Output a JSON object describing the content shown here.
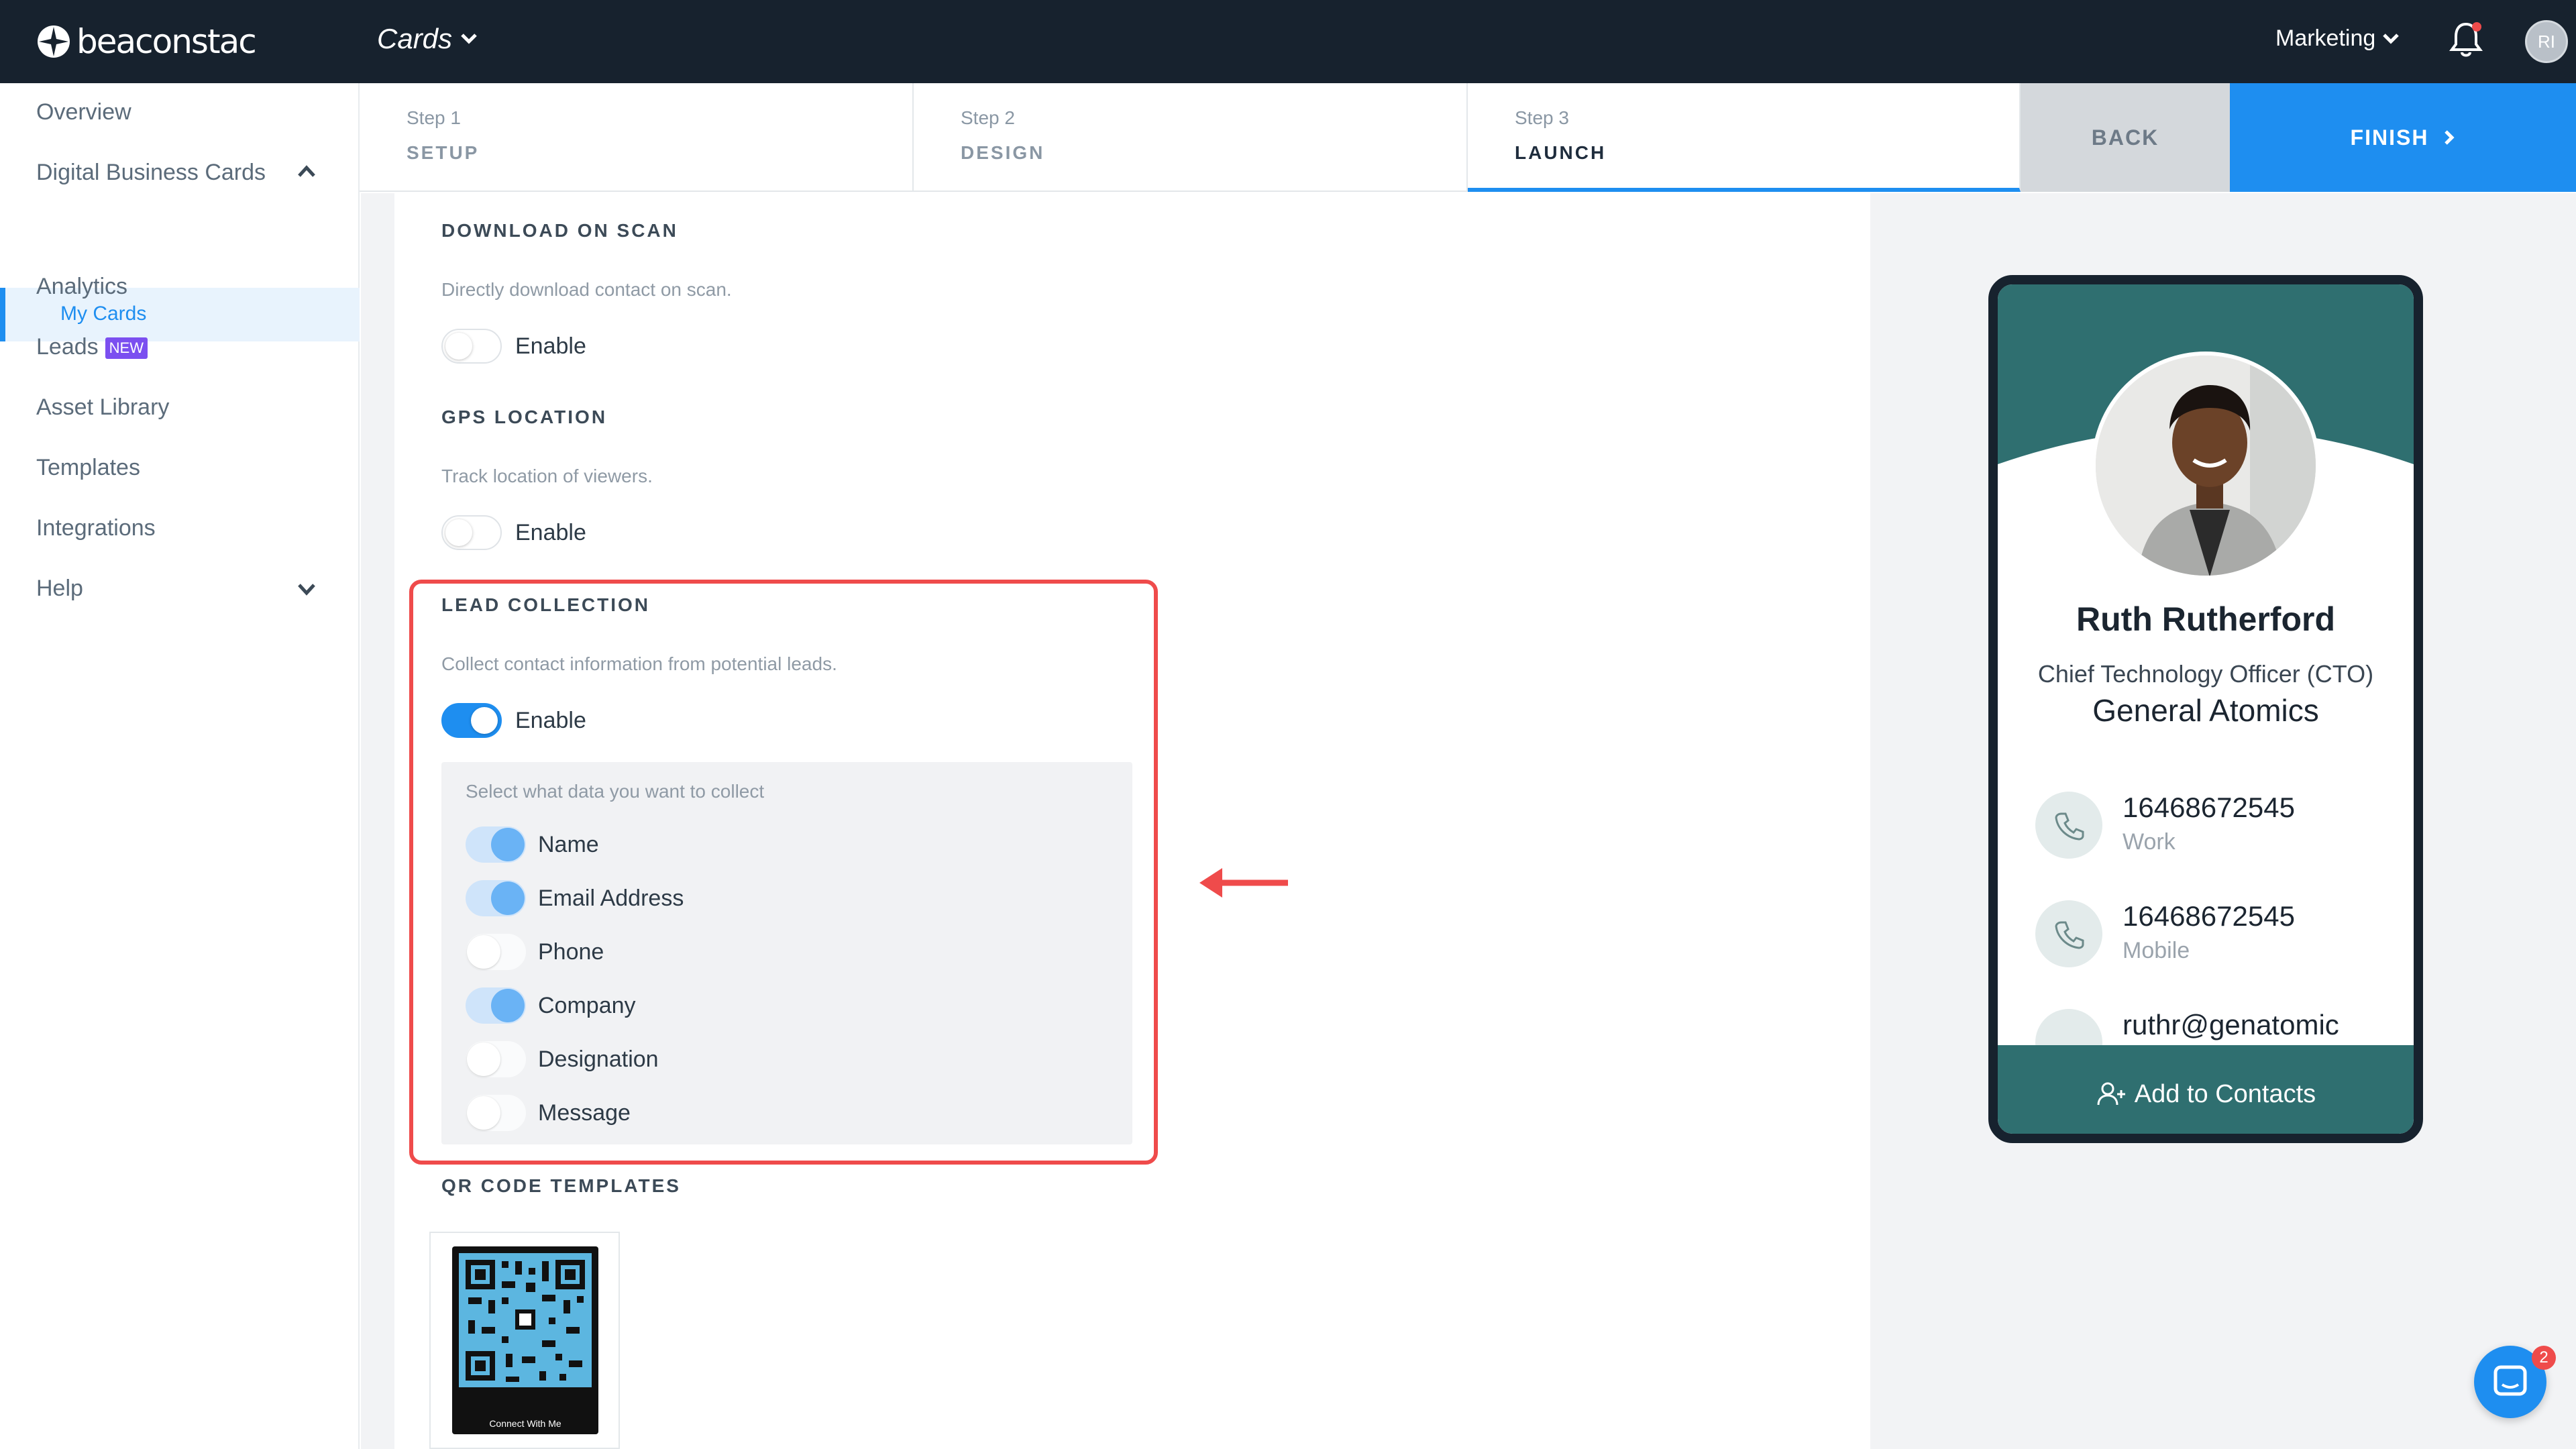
{
  "topbar": {
    "logo_text": "beaconstac",
    "product_label": "Cards",
    "team_label": "Marketing",
    "user_initials": "RI",
    "icons": {
      "bell": "bell-icon",
      "chevron": "chevron-down-icon"
    }
  },
  "sidebar": {
    "items": [
      {
        "label": "Overview"
      },
      {
        "label": "Digital Business Cards"
      },
      {
        "label": "My Cards"
      },
      {
        "label": "Analytics"
      },
      {
        "label": "Leads",
        "badge": "NEW"
      },
      {
        "label": "Asset Library"
      },
      {
        "label": "Templates"
      },
      {
        "label": "Integrations"
      },
      {
        "label": "Help"
      }
    ]
  },
  "steps": [
    {
      "num": "Step 1",
      "name": "SETUP"
    },
    {
      "num": "Step 2",
      "name": "DESIGN"
    },
    {
      "num": "Step 3",
      "name": "LAUNCH"
    }
  ],
  "actions": {
    "back_label": "BACK",
    "finish_label": "FINISH"
  },
  "sections": {
    "download": {
      "title": "DOWNLOAD ON SCAN",
      "desc": "Directly download contact on scan.",
      "toggle_label": "Enable",
      "enabled": false
    },
    "gps": {
      "title": "GPS LOCATION",
      "desc": "Track location of viewers.",
      "toggle_label": "Enable",
      "enabled": false
    },
    "lead": {
      "title": "LEAD COLLECTION",
      "desc": "Collect contact information from potential leads.",
      "toggle_label": "Enable",
      "enabled": true,
      "hint": "Select what data you want to collect",
      "options": [
        {
          "label": "Name",
          "on": true
        },
        {
          "label": "Email Address",
          "on": true
        },
        {
          "label": "Phone",
          "on": false
        },
        {
          "label": "Company",
          "on": true
        },
        {
          "label": "Designation",
          "on": false
        },
        {
          "label": "Message",
          "on": false
        }
      ]
    },
    "qr": {
      "title": "QR CODE TEMPLATES",
      "cta": "Connect With Me"
    }
  },
  "preview": {
    "name": "Ruth Rutherford",
    "title": "Chief Technology Officer (CTO)",
    "company": "General Atomics",
    "contacts": [
      {
        "value": "16468672545",
        "label": "Work",
        "icon": "phone-icon"
      },
      {
        "value": "16468672545",
        "label": "Mobile",
        "icon": "phone-icon"
      },
      {
        "value": "ruthr@genatomic",
        "label": "",
        "icon": "email-icon"
      }
    ],
    "add_label": "Add to Contacts"
  },
  "chat": {
    "badge": "2"
  },
  "colors": {
    "accent": "#1e8ef0",
    "topbar": "#17222e",
    "card_teal": "#2f6f70",
    "highlight": "#ef4b4b",
    "new_badge": "#7b4ff0"
  }
}
